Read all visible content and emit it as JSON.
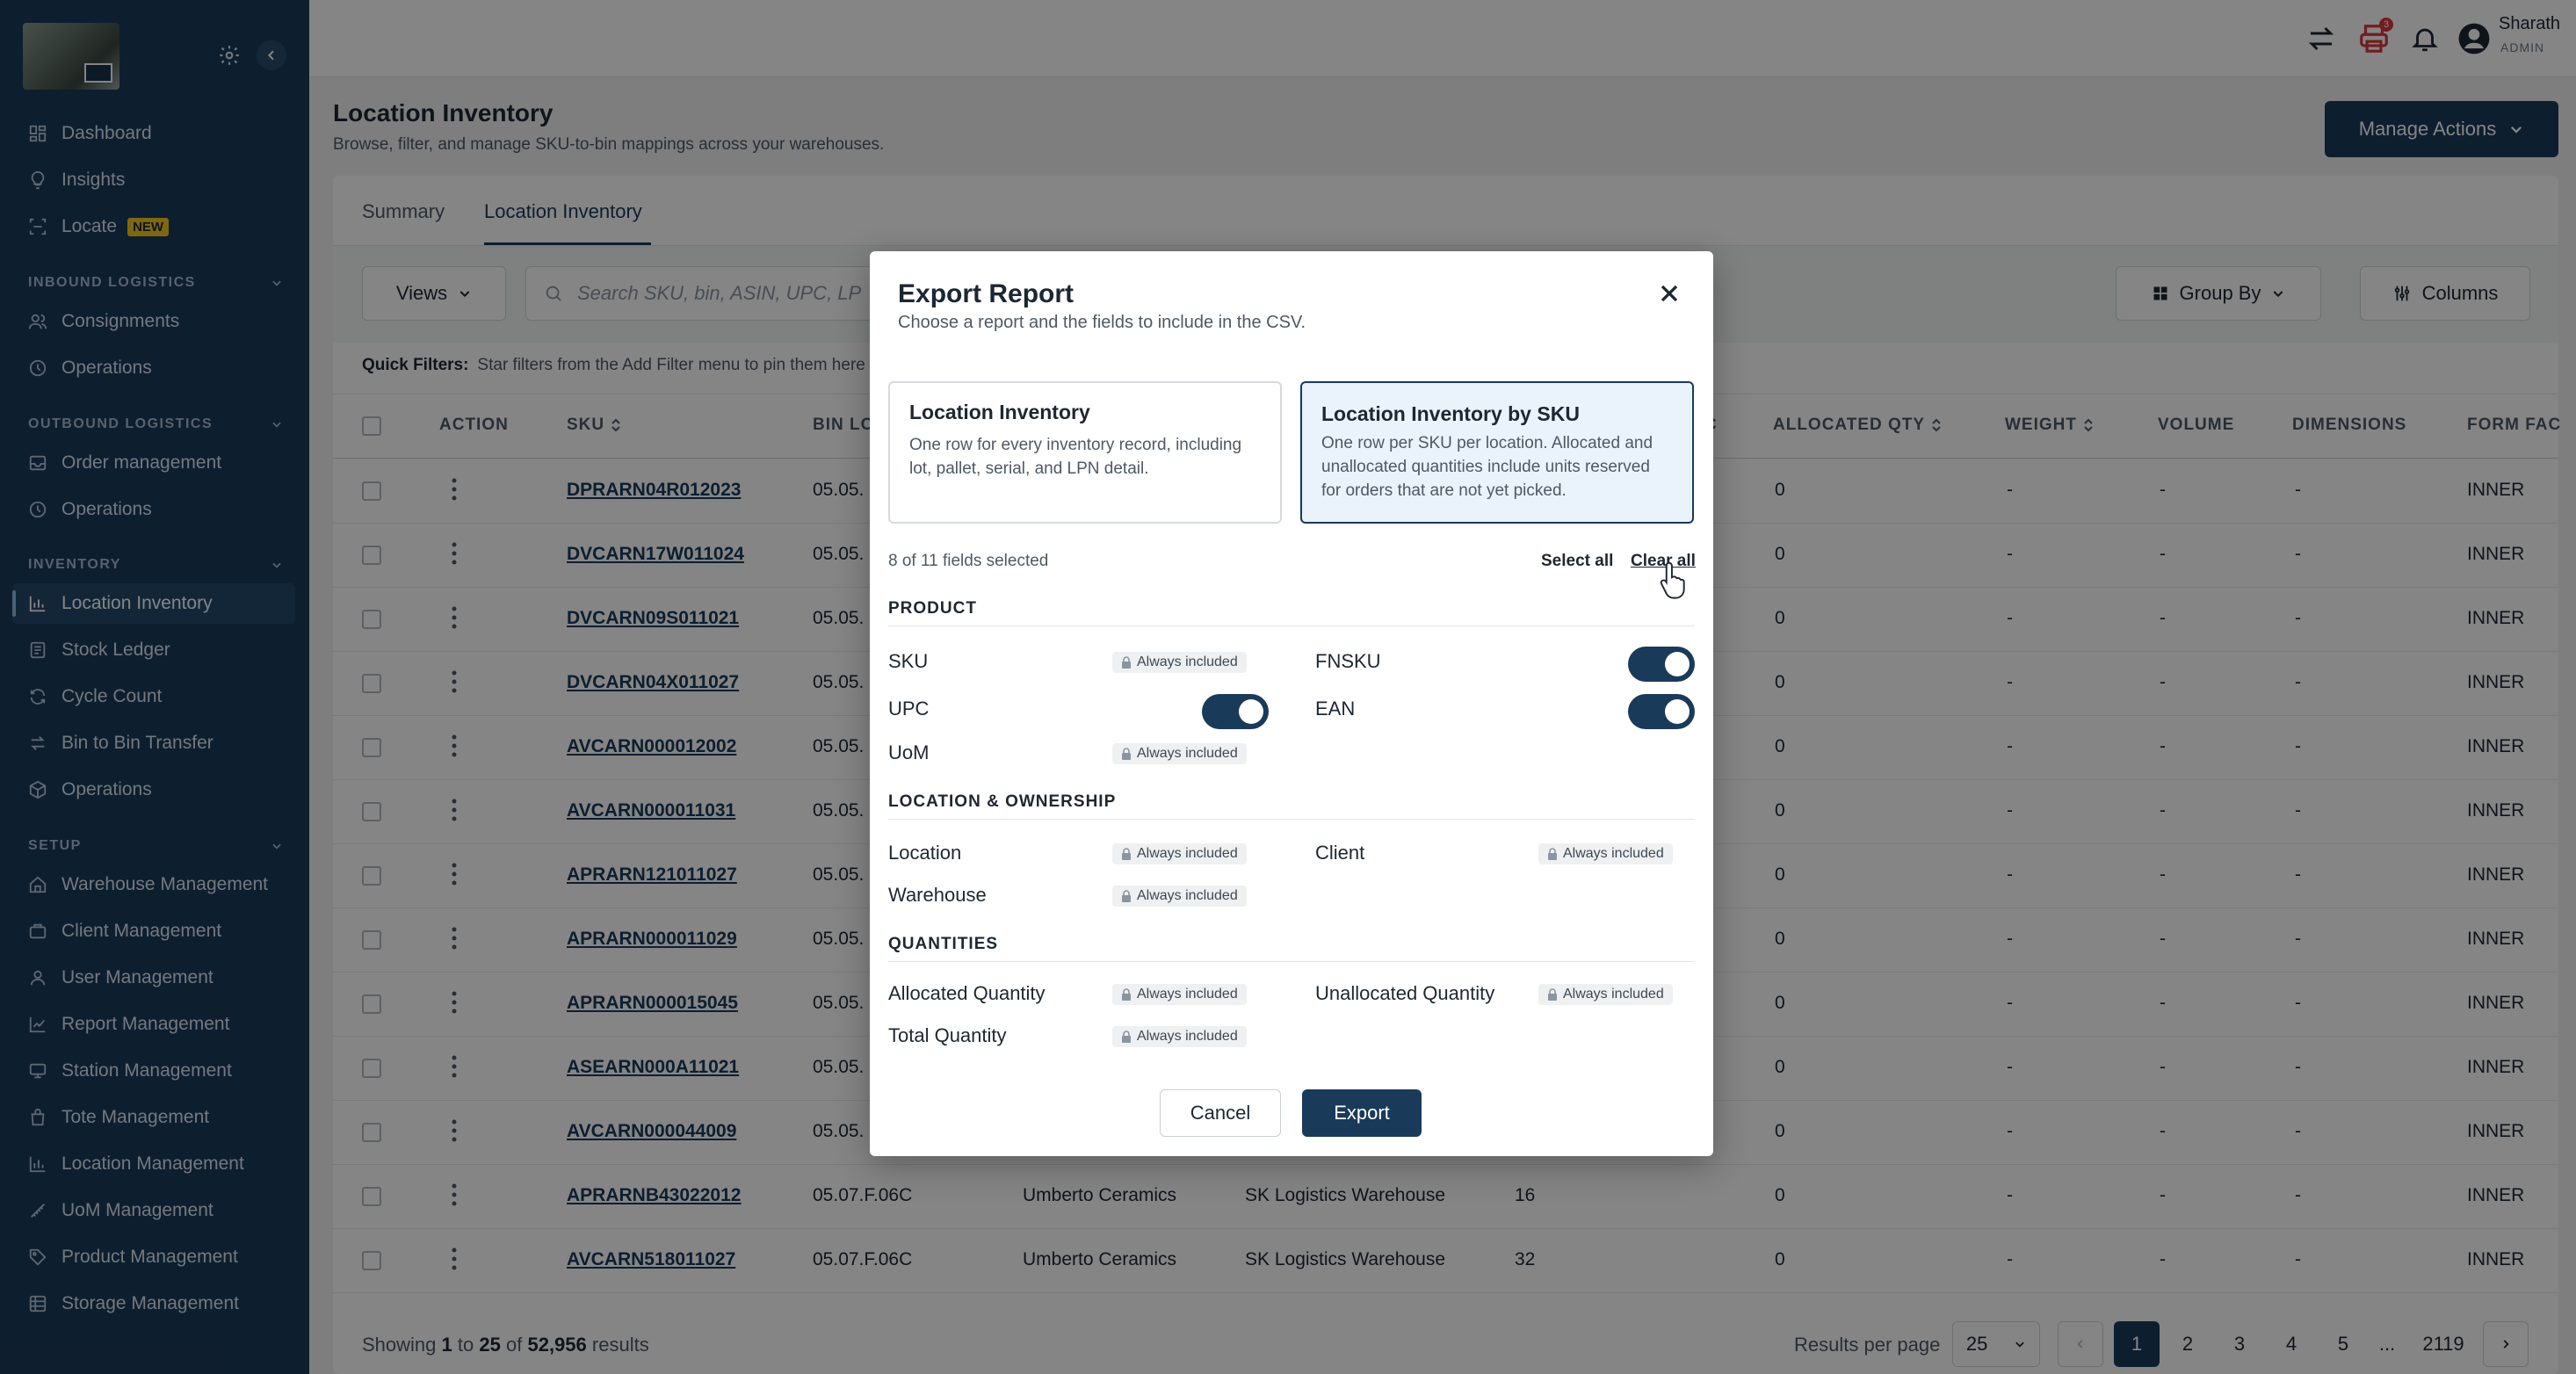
{
  "sidebar": {
    "items": {
      "dashboard": "Dashboard",
      "insights": "Insights",
      "locate": "Locate",
      "locate_badge": "NEW",
      "consignments": "Consignments",
      "inbound_operations": "Operations",
      "order_management": "Order management",
      "outbound_operations": "Operations",
      "location_inventory": "Location Inventory",
      "stock_ledger": "Stock Ledger",
      "cycle_count": "Cycle Count",
      "bin_to_bin": "Bin to Bin Transfer",
      "inventory_operations": "Operations",
      "warehouse_management": "Warehouse Management",
      "client_management": "Client Management",
      "user_management": "User Management",
      "report_management": "Report Management",
      "station_management": "Station Management",
      "tote_management": "Tote Management",
      "location_management": "Location Management",
      "uom_management": "UoM Management",
      "product_management": "Product Management",
      "storage_management": "Storage Management"
    },
    "sections": {
      "inbound": "INBOUND LOGISTICS",
      "outbound": "OUTBOUND LOGISTICS",
      "inventory": "INVENTORY",
      "setup": "SETUP"
    }
  },
  "topbar": {
    "user_name": "Sharath",
    "user_role": "ADMIN",
    "notification_count": "3"
  },
  "page": {
    "title": "Location Inventory",
    "subtitle": "Browse, filter, and manage SKU-to-bin mappings across your warehouses.",
    "manage_actions": "Manage Actions",
    "tabs": [
      "Summary",
      "Location Inventory"
    ],
    "views_label": "Views",
    "search_placeholder": "Search SKU, bin, ASIN, UPC, LP",
    "group_by": "Group By",
    "columns": "Columns",
    "quick_filters_label": "Quick Filters:",
    "quick_filters_hint": "Star filters from the Add Filter menu to pin them here"
  },
  "table": {
    "headers": {
      "action": "ACTION",
      "sku": "SKU",
      "bin": "BIN LO",
      "qty_fragment": "C",
      "allocated_qty": "ALLOCATED QTY",
      "weight": "WEIGHT",
      "volume": "VOLUME",
      "dimensions": "DIMENSIONS",
      "form_factor": "FORM FAC"
    },
    "rows": [
      {
        "sku": "DPRARN04R012023",
        "bin": "05.05.",
        "client": "",
        "warehouse": "",
        "qty": "",
        "allocated": "0",
        "weight": "-",
        "volume": "-",
        "dimensions": "-",
        "form": "INNER"
      },
      {
        "sku": "DVCARN17W011024",
        "bin": "05.05.",
        "client": "",
        "warehouse": "",
        "qty": "",
        "allocated": "0",
        "weight": "-",
        "volume": "-",
        "dimensions": "-",
        "form": "INNER"
      },
      {
        "sku": "DVCARN09S011021",
        "bin": "05.05.",
        "client": "",
        "warehouse": "",
        "qty": "",
        "allocated": "0",
        "weight": "-",
        "volume": "-",
        "dimensions": "-",
        "form": "INNER"
      },
      {
        "sku": "DVCARN04X011027",
        "bin": "05.05.",
        "client": "",
        "warehouse": "",
        "qty": "",
        "allocated": "0",
        "weight": "-",
        "volume": "-",
        "dimensions": "-",
        "form": "INNER"
      },
      {
        "sku": "AVCARN000012002",
        "bin": "05.05.",
        "client": "",
        "warehouse": "",
        "qty": "",
        "allocated": "0",
        "weight": "-",
        "volume": "-",
        "dimensions": "-",
        "form": "INNER"
      },
      {
        "sku": "AVCARN000011031",
        "bin": "05.05.",
        "client": "",
        "warehouse": "",
        "qty": "",
        "allocated": "0",
        "weight": "-",
        "volume": "-",
        "dimensions": "-",
        "form": "INNER"
      },
      {
        "sku": "APRARN121011027",
        "bin": "05.05.",
        "client": "",
        "warehouse": "",
        "qty": "",
        "allocated": "0",
        "weight": "-",
        "volume": "-",
        "dimensions": "-",
        "form": "INNER"
      },
      {
        "sku": "APRARN000011029",
        "bin": "05.05.",
        "client": "",
        "warehouse": "",
        "qty": "",
        "allocated": "0",
        "weight": "-",
        "volume": "-",
        "dimensions": "-",
        "form": "INNER"
      },
      {
        "sku": "APRARN000015045",
        "bin": "05.05.",
        "client": "",
        "warehouse": "",
        "qty": "",
        "allocated": "0",
        "weight": "-",
        "volume": "-",
        "dimensions": "-",
        "form": "INNER"
      },
      {
        "sku": "ASEARN000A11021",
        "bin": "05.05.",
        "client": "",
        "warehouse": "",
        "qty": "",
        "allocated": "0",
        "weight": "-",
        "volume": "-",
        "dimensions": "-",
        "form": "INNER"
      },
      {
        "sku": "AVCARN000044009",
        "bin": "05.05.",
        "client": "",
        "warehouse": "",
        "qty": "",
        "allocated": "0",
        "weight": "-",
        "volume": "-",
        "dimensions": "-",
        "form": "INNER"
      },
      {
        "sku": "APRARNB43022012",
        "bin": "05.07.F.06C",
        "client": "Umberto Ceramics",
        "warehouse": "SK Logistics Warehouse",
        "qty": "16",
        "allocated": "0",
        "weight": "-",
        "volume": "-",
        "dimensions": "-",
        "form": "INNER"
      },
      {
        "sku": "AVCARN518011027",
        "bin": "05.07.F.06C",
        "client": "Umberto Ceramics",
        "warehouse": "SK Logistics Warehouse",
        "qty": "32",
        "allocated": "0",
        "weight": "-",
        "volume": "-",
        "dimensions": "-",
        "form": "INNER"
      }
    ]
  },
  "footer": {
    "showing_prefix": "Showing",
    "from": "1",
    "to_word": "to",
    "to": "25",
    "of_word": "of",
    "total": "52,956",
    "results_word": "results",
    "results_per_page_label": "Results per page",
    "results_per_page": "25",
    "pages": [
      "1",
      "2",
      "3",
      "4",
      "5"
    ],
    "ellipsis": "...",
    "last_page": "2119"
  },
  "modal": {
    "title": "Export Report",
    "subtitle": "Choose a report and the fields to include in the CSV.",
    "reports": [
      {
        "title": "Location Inventory",
        "desc": "One row for every inventory record, including lot, pallet, serial, and LPN detail.",
        "selected": false
      },
      {
        "title": "Location Inventory by SKU",
        "desc": "One row per SKU per location. Allocated and unallocated quantities include units reserved for orders that are not yet picked.",
        "selected": true
      }
    ],
    "fields_selected": "8 of 11 fields selected",
    "select_all": "Select all",
    "clear_all": "Clear all",
    "always_included": "Always included",
    "groups": {
      "product": "PRODUCT",
      "location": "LOCATION & OWNERSHIP",
      "quantities": "QUANTITIES"
    },
    "fields": {
      "sku": "SKU",
      "fnsku": "FNSKU",
      "upc": "UPC",
      "ean": "EAN",
      "uom": "UoM",
      "location": "Location",
      "client": "Client",
      "warehouse": "Warehouse",
      "allocated_quantity": "Allocated Quantity",
      "unallocated_quantity": "Unallocated Quantity",
      "total_quantity": "Total Quantity"
    },
    "cancel": "Cancel",
    "export": "Export"
  },
  "colors": {
    "sidebar": "#1a3a5a",
    "accent": "#1a3a5a",
    "badge_new": "#f3c623",
    "notif": "#d9363e"
  }
}
